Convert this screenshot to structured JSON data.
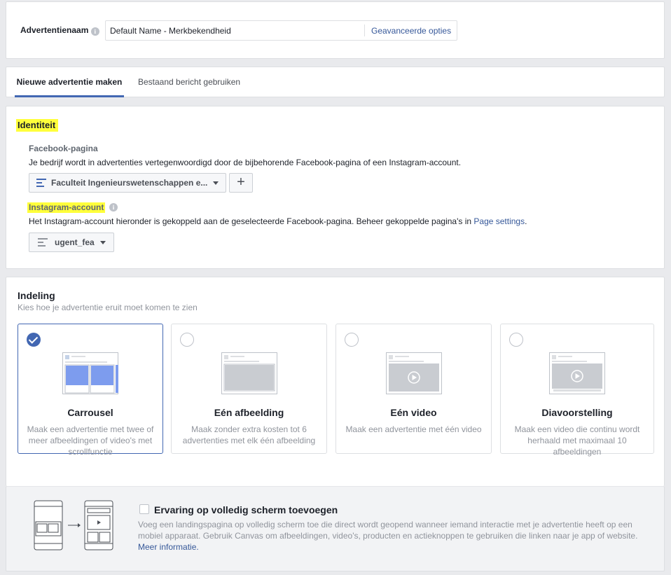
{
  "ad_name": {
    "label": "Advertentienaam",
    "info_icon": "info-icon",
    "value": "Default Name - Merkbekendheid",
    "advanced_options": "Geavanceerde opties"
  },
  "tabs": [
    {
      "label": "Nieuwe advertentie maken",
      "active": true
    },
    {
      "label": "Bestaand bericht gebruiken",
      "active": false
    }
  ],
  "identity": {
    "title": "Identiteit",
    "highlight_color": "#ffff3b",
    "facebook_page": {
      "label": "Facebook-pagina",
      "description": "Je bedrijf wordt in advertenties vertegenwoordigd door de bijbehorende Facebook-pagina of een Instagram-account.",
      "selected": "Faculteit Ingenieurswetenschappen e...",
      "add_symbol": "+"
    },
    "instagram": {
      "label": "Instagram-account",
      "description_prefix": "Het Instagram-account hieronder is gekoppeld aan de geselecteerde Facebook-pagina. Beheer gekoppelde pagina's in ",
      "link": "Page settings",
      "description_suffix": ".",
      "selected": "ugent_fea"
    }
  },
  "format": {
    "title": "Indeling",
    "subtitle": "Kies hoe je advertentie eruit moet komen te zien",
    "accent_color": "#4267b2",
    "options": [
      {
        "name": "Carrousel",
        "description": "Maak een advertentie met twee of meer afbeeldingen of video's met scrollfunctie",
        "selected": true
      },
      {
        "name": "Eén afbeelding",
        "description": "Maak zonder extra kosten tot 6 advertenties met elk één afbeelding",
        "selected": false
      },
      {
        "name": "Eén video",
        "description": "Maak een advertentie met één video",
        "selected": false
      },
      {
        "name": "Diavoorstelling",
        "description": "Maak een video die continu wordt herhaald met maximaal 10 afbeeldingen",
        "selected": false
      }
    ]
  },
  "canvas": {
    "checkbox_label": "Ervaring op volledig scherm toevoegen",
    "checked": false,
    "description": "Voeg een landingspagina op volledig scherm toe die direct wordt geopend wanneer iemand interactie met je advertentie heeft op een mobiel apparaat. Gebruik Canvas om afbeeldingen, video's, producten en actieknoppen te gebruiken die linken naar je app of website.",
    "more_info": "Meer informatie."
  }
}
